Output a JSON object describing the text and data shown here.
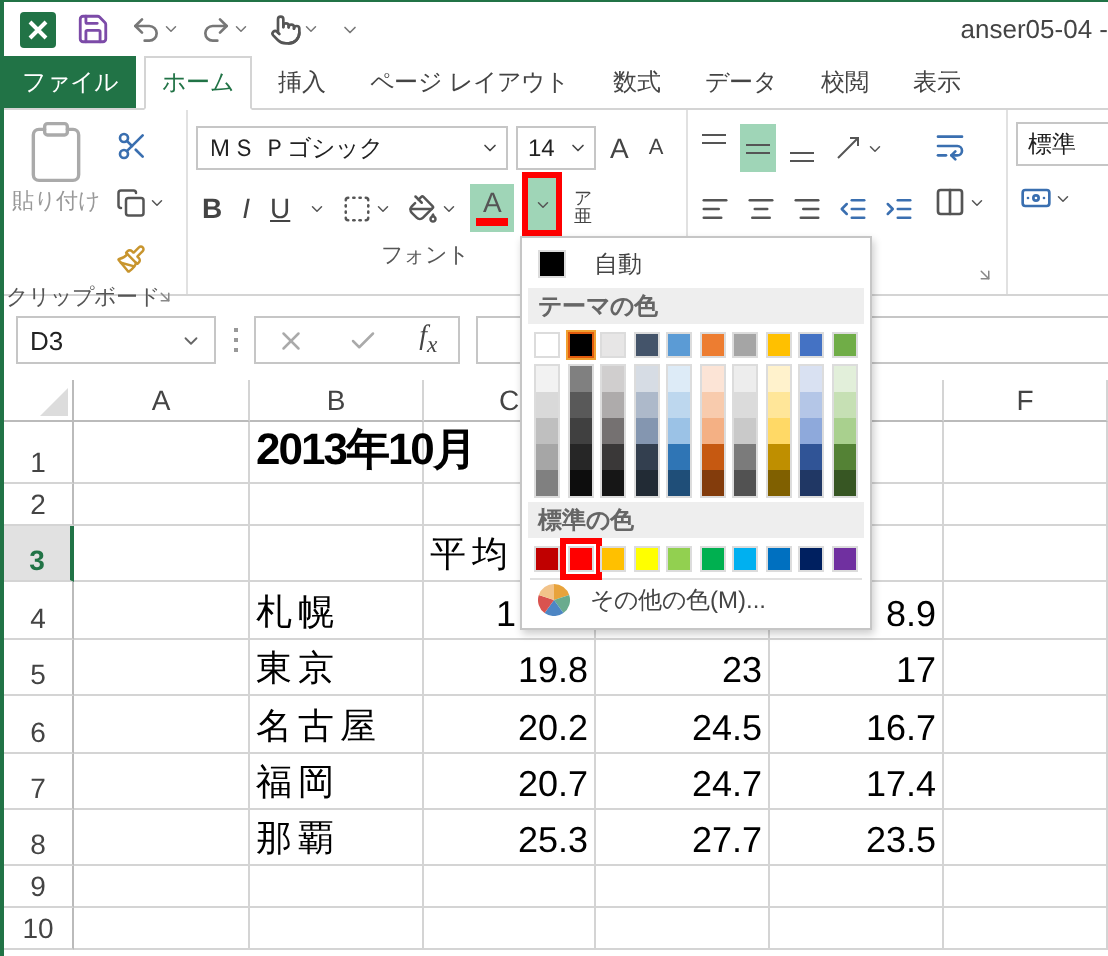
{
  "title_bar": {
    "title": "anser05-04 -"
  },
  "tabs": [
    {
      "label": "ファイル",
      "kind": "file",
      "selected": false
    },
    {
      "label": "ホーム",
      "kind": "tab",
      "selected": true
    },
    {
      "label": "挿入",
      "kind": "tab",
      "selected": false
    },
    {
      "label": "ページ レイアウト",
      "kind": "tab",
      "selected": false
    },
    {
      "label": "数式",
      "kind": "tab",
      "selected": false
    },
    {
      "label": "データ",
      "kind": "tab",
      "selected": false
    },
    {
      "label": "校閲",
      "kind": "tab",
      "selected": false
    },
    {
      "label": "表示",
      "kind": "tab",
      "selected": false
    }
  ],
  "ribbon": {
    "clipboard": {
      "paste_label": "貼り付け",
      "group_label": "クリップボード"
    },
    "font": {
      "font_name": "ＭＳ Ｐゴシック",
      "font_size": "14",
      "grow": "A",
      "shrink": "A",
      "bold": "B",
      "italic": "I",
      "underline": "U",
      "font_color": {
        "glyph": "A",
        "active": true,
        "highlighted": true
      },
      "phonetic": {
        "top": "ア",
        "bottom": "亜"
      },
      "group_label": "フォント"
    },
    "alignment": {
      "vertical": [
        {
          "kind": "top",
          "selected": false
        },
        {
          "kind": "middle",
          "selected": true
        },
        {
          "kind": "bottom",
          "selected": false
        }
      ]
    },
    "number": {
      "format": "標準"
    }
  },
  "formula_bar": {
    "name_box": "D3",
    "function": "f$_{x}$"
  },
  "sheet": {
    "columns": {
      "a": "A",
      "b": "B",
      "c": "C",
      "f": "F"
    },
    "rows": [
      {
        "number": "1",
        "selected": false,
        "b": {
          "text": "2013年10月",
          "kind": "title"
        }
      },
      {
        "number": "2",
        "selected": false
      },
      {
        "number": "3",
        "selected": true,
        "c": {
          "text": "平均",
          "kind": "heading"
        }
      },
      {
        "number": "4",
        "selected": false,
        "b": "札幌",
        "c": {
          "text": "1",
          "kind": "partial"
        },
        "e": "8.9"
      },
      {
        "number": "5",
        "selected": false,
        "b": "東京",
        "c": "19.8",
        "d": "23",
        "e": "17"
      },
      {
        "number": "6",
        "selected": false,
        "b": "名古屋",
        "c": "20.2",
        "d": "24.5",
        "e": "16.7"
      },
      {
        "number": "7",
        "selected": false,
        "b": "福岡",
        "c": "20.7",
        "d": "24.7",
        "e": "17.4"
      },
      {
        "number": "8",
        "selected": false,
        "b": "那覇",
        "c": "25.3",
        "d": "27.7",
        "e": "23.5"
      },
      {
        "number": "9",
        "selected": false
      },
      {
        "number": "10",
        "selected": false
      }
    ]
  },
  "color_menu": {
    "automatic": {
      "label": "自動",
      "color": "#000000"
    },
    "theme_header": "テーマの色",
    "theme_colors": [
      {
        "color": "#ffffff",
        "selected": false,
        "shades": [
          {
            "color": "#f2f2f2"
          },
          {
            "color": "#d9d9d9"
          },
          {
            "color": "#bfbfbf"
          },
          {
            "color": "#a6a6a6"
          },
          {
            "color": "#808080"
          }
        ]
      },
      {
        "color": "#000000",
        "selected": true,
        "shades": [
          {
            "color": "#808080"
          },
          {
            "color": "#595959"
          },
          {
            "color": "#404040"
          },
          {
            "color": "#262626"
          },
          {
            "color": "#0d0d0d"
          }
        ]
      },
      {
        "color": "#e7e6e6",
        "selected": false,
        "shades": [
          {
            "color": "#d0cece"
          },
          {
            "color": "#aeabab"
          },
          {
            "color": "#757171"
          },
          {
            "color": "#3a3838"
          },
          {
            "color": "#161616"
          }
        ]
      },
      {
        "color": "#44546a",
        "selected": false,
        "shades": [
          {
            "color": "#d6dce4"
          },
          {
            "color": "#adb9ca"
          },
          {
            "color": "#8496b0"
          },
          {
            "color": "#333f4f"
          },
          {
            "color": "#222b35"
          }
        ]
      },
      {
        "color": "#5b9bd5",
        "selected": false,
        "shades": [
          {
            "color": "#ddebf7"
          },
          {
            "color": "#bdd7ee"
          },
          {
            "color": "#9bc2e6"
          },
          {
            "color": "#2f75b5"
          },
          {
            "color": "#1f4e78"
          }
        ]
      },
      {
        "color": "#ed7d31",
        "selected": false,
        "shades": [
          {
            "color": "#fce4d6"
          },
          {
            "color": "#f8cbad"
          },
          {
            "color": "#f4b084"
          },
          {
            "color": "#c65911"
          },
          {
            "color": "#833c0c"
          }
        ]
      },
      {
        "color": "#a5a5a5",
        "selected": false,
        "shades": [
          {
            "color": "#ededed"
          },
          {
            "color": "#dbdbdb"
          },
          {
            "color": "#c9c9c9"
          },
          {
            "color": "#7b7b7b"
          },
          {
            "color": "#525252"
          }
        ]
      },
      {
        "color": "#ffc000",
        "selected": false,
        "shades": [
          {
            "color": "#fff2cc"
          },
          {
            "color": "#ffe699"
          },
          {
            "color": "#ffd966"
          },
          {
            "color": "#bf8f00"
          },
          {
            "color": "#806000"
          }
        ]
      },
      {
        "color": "#4472c4",
        "selected": false,
        "shades": [
          {
            "color": "#d9e1f2"
          },
          {
            "color": "#b4c6e7"
          },
          {
            "color": "#8ea9db"
          },
          {
            "color": "#305496"
          },
          {
            "color": "#203764"
          }
        ]
      },
      {
        "color": "#70ad47",
        "selected": false,
        "shades": [
          {
            "color": "#e2efda"
          },
          {
            "color": "#c6e0b4"
          },
          {
            "color": "#a9d08e"
          },
          {
            "color": "#548235"
          },
          {
            "color": "#375623"
          }
        ]
      }
    ],
    "standard_header": "標準の色",
    "standard_colors": [
      {
        "color": "#c00000",
        "selected": false
      },
      {
        "color": "#ff0000",
        "selected": true
      },
      {
        "color": "#ffc000",
        "selected": false
      },
      {
        "color": "#ffff00",
        "selected": false
      },
      {
        "color": "#92d050",
        "selected": false
      },
      {
        "color": "#00b050",
        "selected": false
      },
      {
        "color": "#00b0f0",
        "selected": false
      },
      {
        "color": "#0070c0",
        "selected": false
      },
      {
        "color": "#002060",
        "selected": false
      },
      {
        "color": "#7030a0",
        "selected": false
      }
    ],
    "more_colors": "その他の色(M)..."
  }
}
